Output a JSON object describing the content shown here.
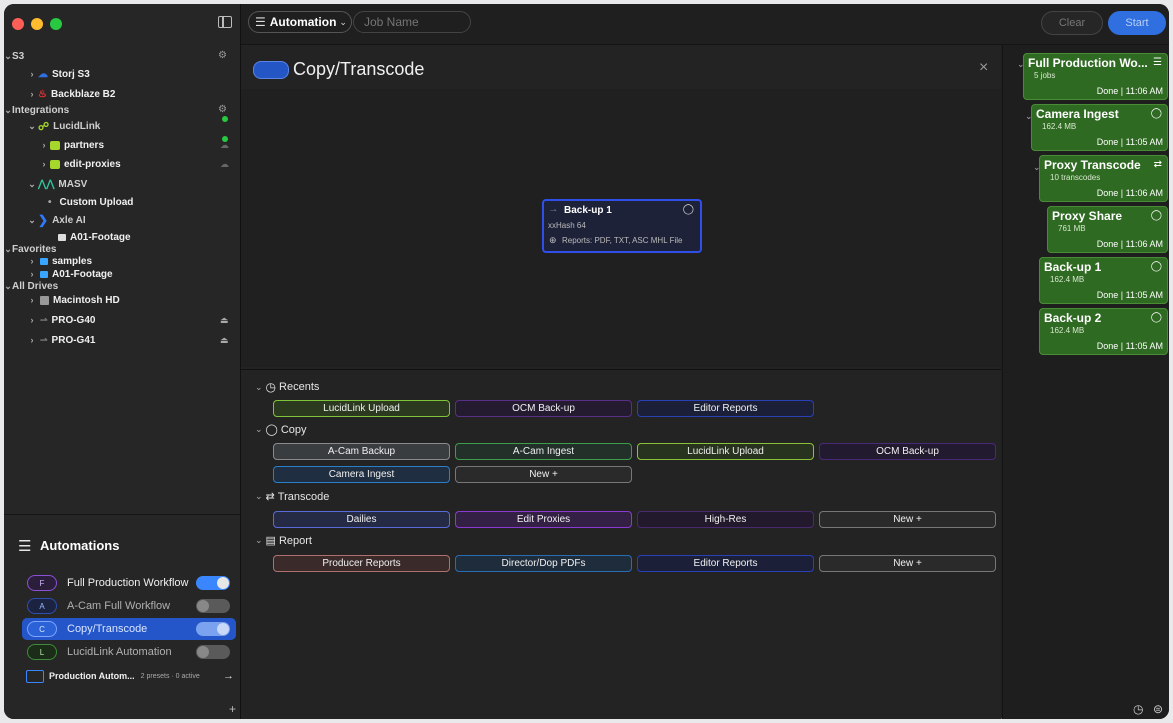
{
  "sidebar": {
    "tree": {
      "s3": {
        "label": "S3",
        "items": [
          "Storj S3",
          "Backblaze B2"
        ]
      },
      "integrations": {
        "label": "Integrations"
      },
      "lucidlink": {
        "label": "LucidLink",
        "items": [
          "partners",
          "edit-proxies"
        ]
      },
      "masv": {
        "label": "MASV",
        "items": [
          "Custom Upload"
        ]
      },
      "axle": {
        "label": "Axle AI",
        "items": [
          "A01-Footage"
        ]
      },
      "favorites": {
        "label": "Favorites",
        "items": [
          "samples",
          "A01-Footage"
        ]
      },
      "drives": {
        "label": "All Drives",
        "items": [
          "Macintosh HD",
          "PRO-G40",
          "PRO-G41"
        ]
      }
    },
    "automations": {
      "title": "Automations",
      "items": [
        {
          "letter": "F",
          "label": "Full Production Workflow",
          "on": true
        },
        {
          "letter": "A",
          "label": "A-Cam Full Workflow",
          "on": false
        },
        {
          "letter": "C",
          "label": "Copy/Transcode",
          "on": true,
          "selected": true
        },
        {
          "letter": "L",
          "label": "LucidLink Automation",
          "on": false
        }
      ],
      "folder": {
        "label": "Production Autom...",
        "meta": "2 presets · 0 active"
      }
    }
  },
  "topbar": {
    "automation_label": "Automation",
    "job_placeholder": "Job Name",
    "clear_label": "Clear",
    "start_label": "Start"
  },
  "canvas": {
    "title": "Copy/Transcode",
    "node": {
      "title": "Back-up 1",
      "hash": "xxHash 64",
      "reports": "Reports: PDF, TXT, ASC MHL File"
    }
  },
  "presets": {
    "recents": {
      "label": "Recents",
      "buttons": [
        "LucidLink Upload",
        "OCM Back-up",
        "Editor Reports"
      ]
    },
    "copy": {
      "label": "Copy",
      "buttons": [
        "A-Cam Backup",
        "A-Cam Ingest",
        "LucidLink Upload",
        "OCM Back-up",
        "Camera Ingest",
        "New +"
      ]
    },
    "transcode": {
      "label": "Transcode",
      "buttons": [
        "Dailies",
        "Edit Proxies",
        "High-Res",
        "New +"
      ]
    },
    "report": {
      "label": "Report",
      "buttons": [
        "Producer Reports",
        "Director/Dop PDFs",
        "Editor Reports",
        "New +"
      ]
    }
  },
  "jobs": [
    {
      "title": "Full Production Wo...",
      "sub": "5 jobs",
      "done": "Done | 11:06 AM"
    },
    {
      "title": "Camera Ingest",
      "sub": "162.4 MB",
      "done": "Done | 11:05 AM"
    },
    {
      "title": "Proxy Transcode",
      "sub": "10 transcodes",
      "done": "Done | 11:06 AM"
    },
    {
      "title": "Proxy Share",
      "sub": "761 MB",
      "done": "Done | 11:06 AM"
    },
    {
      "title": "Back-up 1",
      "sub": "162.4 MB",
      "done": "Done | 11:05 AM"
    },
    {
      "title": "Back-up 2",
      "sub": "162.4 MB",
      "done": "Done | 11:05 AM"
    }
  ],
  "colors": {
    "accent": "#2f6fe0",
    "job_green": "#2f6a22",
    "selected_row": "#2456c9"
  }
}
